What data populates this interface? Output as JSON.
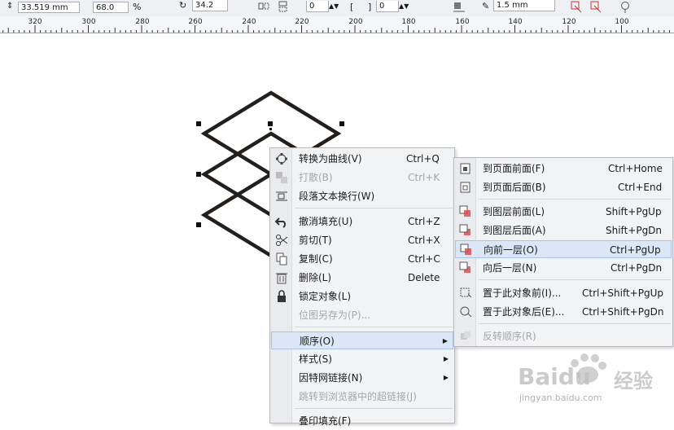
{
  "propbar": {
    "height_value": "33.519 mm",
    "scale_value": "68.0",
    "scale_unit": "%",
    "angle_value": "34.2",
    "field_a_value": "0",
    "field_b_value": "0",
    "outline_width_value": "1.5 mm"
  },
  "ruler": {
    "labels": [
      "320",
      "300",
      "280",
      "260",
      "240",
      "220",
      "200",
      "180",
      "160",
      "140",
      "120",
      "100"
    ]
  },
  "context_menu": {
    "items": [
      {
        "label": "转换为曲线(V)",
        "shortcut": "Ctrl+Q",
        "icon": "convert-curve-icon",
        "disabled": false
      },
      {
        "label": "打散(B)",
        "shortcut": "Ctrl+K",
        "icon": "break-apart-icon",
        "disabled": true
      },
      {
        "label": "段落文本换行(W)",
        "shortcut": "",
        "icon": "text-wrap-icon",
        "disabled": false
      },
      {
        "label": "撤消填充(U)",
        "shortcut": "Ctrl+Z",
        "icon": "undo-icon",
        "disabled": false
      },
      {
        "label": "剪切(T)",
        "shortcut": "Ctrl+X",
        "icon": "scissors-icon",
        "disabled": false
      },
      {
        "label": "复制(C)",
        "shortcut": "Ctrl+C",
        "icon": "copy-icon",
        "disabled": false
      },
      {
        "label": "删除(L)",
        "shortcut": "Delete",
        "icon": "trash-icon",
        "disabled": false
      },
      {
        "label": "锁定对象(L)",
        "shortcut": "",
        "icon": "lock-icon",
        "disabled": false
      },
      {
        "label": "位图另存为(P)...",
        "shortcut": "",
        "icon": "",
        "disabled": true
      },
      {
        "label": "顺序(O)",
        "shortcut": "",
        "icon": "",
        "disabled": false,
        "submenu": true
      },
      {
        "label": "样式(S)",
        "shortcut": "",
        "icon": "",
        "disabled": false,
        "submenu": true
      },
      {
        "label": "因特网链接(N)",
        "shortcut": "",
        "icon": "",
        "disabled": false,
        "submenu": true
      },
      {
        "label": "跳转到浏览器中的超链接(J)",
        "shortcut": "",
        "icon": "",
        "disabled": true
      },
      {
        "label": "叠印填充(F)",
        "shortcut": "",
        "icon": "",
        "disabled": false
      }
    ]
  },
  "order_submenu": {
    "items": [
      {
        "label": "到页面前面(F)",
        "shortcut": "Ctrl+Home",
        "disabled": false
      },
      {
        "label": "到页面后面(B)",
        "shortcut": "Ctrl+End",
        "disabled": false
      },
      {
        "label": "到图层前面(L)",
        "shortcut": "Shift+PgUp",
        "disabled": false
      },
      {
        "label": "到图层后面(A)",
        "shortcut": "Shift+PgDn",
        "disabled": false
      },
      {
        "label": "向前一层(O)",
        "shortcut": "Ctrl+PgUp",
        "disabled": false
      },
      {
        "label": "向后一层(N)",
        "shortcut": "Ctrl+PgDn",
        "disabled": false
      },
      {
        "label": "置于此对象前(I)...",
        "shortcut": "Ctrl+Shift+PgUp",
        "disabled": false
      },
      {
        "label": "置于此对象后(E)...",
        "shortcut": "Ctrl+Shift+PgDn",
        "disabled": false
      },
      {
        "label": "反转顺序(R)",
        "shortcut": "",
        "disabled": true
      }
    ]
  },
  "watermark": {
    "brand": "Baidu",
    "brand_cn": "经验",
    "url": "jingyan.baidu.com"
  }
}
